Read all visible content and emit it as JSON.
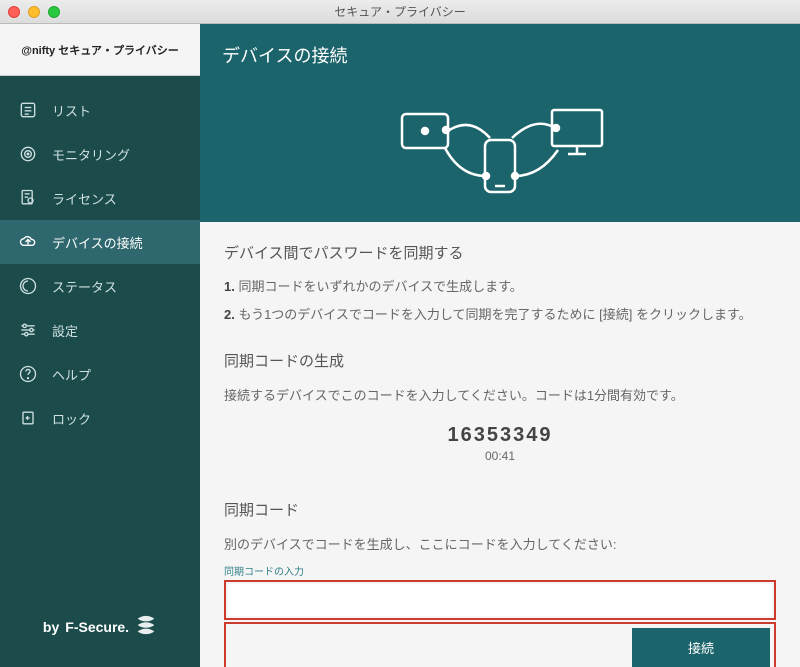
{
  "titlebar": {
    "title": "セキュア・プライバシー"
  },
  "brand": "@nifty セキュア・プライバシー",
  "sidebar": {
    "items": [
      {
        "label": "リスト"
      },
      {
        "label": "モニタリング"
      },
      {
        "label": "ライセンス"
      },
      {
        "label": "デバイスの接続"
      },
      {
        "label": "ステータス"
      },
      {
        "label": "設定"
      },
      {
        "label": "ヘルプ"
      },
      {
        "label": "ロック"
      }
    ],
    "footer_prefix": "by ",
    "footer_brand": "F-Secure."
  },
  "hero": {
    "title": "デバイスの接続"
  },
  "sync": {
    "heading": "デバイス間でパスワードを同期する",
    "step1_num": "1.",
    "step1_text": "同期コードをいずれかのデバイスで生成します。",
    "step2_num": "2.",
    "step2_text": "もう1つのデバイスでコードを入力して同期を完了するために [接続] をクリックします。"
  },
  "gen": {
    "heading": "同期コードの生成",
    "desc": "接続するデバイスでこのコードを入力してください。コードは1分間有効です。",
    "code": "16353349",
    "timer": "00:41"
  },
  "enter": {
    "heading": "同期コード",
    "desc": "別のデバイスでコードを生成し、ここにコードを入力してください:",
    "input_label": "同期コードの入力",
    "button": "接続"
  }
}
